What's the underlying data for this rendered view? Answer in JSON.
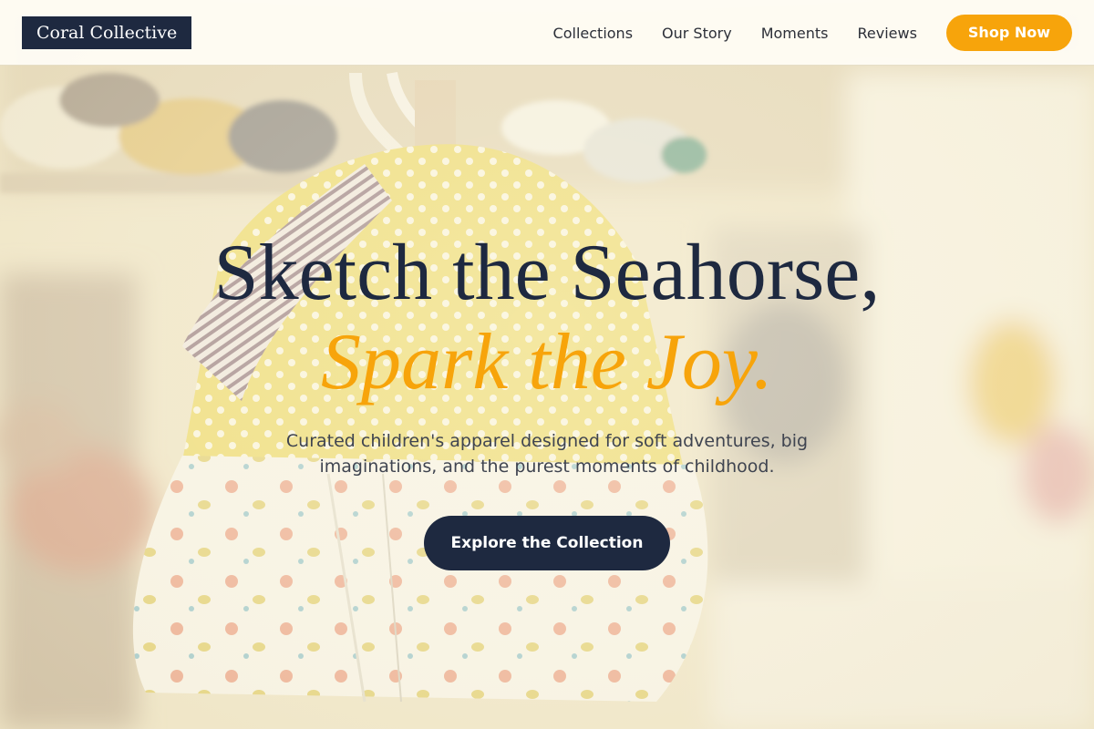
{
  "header": {
    "logo_text": "Coral Collective",
    "nav": [
      {
        "label": "Collections"
      },
      {
        "label": "Our Story"
      },
      {
        "label": "Moments"
      },
      {
        "label": "Reviews"
      }
    ],
    "cta_label": "Shop Now"
  },
  "hero": {
    "headline": "Sketch the Seahorse,",
    "headline_accent": "Spark the Joy.",
    "subtitle": "Curated children's apparel designed for soft adventures, big imaginations, and the purest moments of childhood.",
    "cta_label": "Explore the Collection"
  },
  "colors": {
    "navy": "#1e2940",
    "accent": "#f7a40b",
    "text_muted": "#3f4450",
    "header_bg": "#fffdf6"
  },
  "icons": {
    "hero_image": "baby-clothes-photo"
  }
}
